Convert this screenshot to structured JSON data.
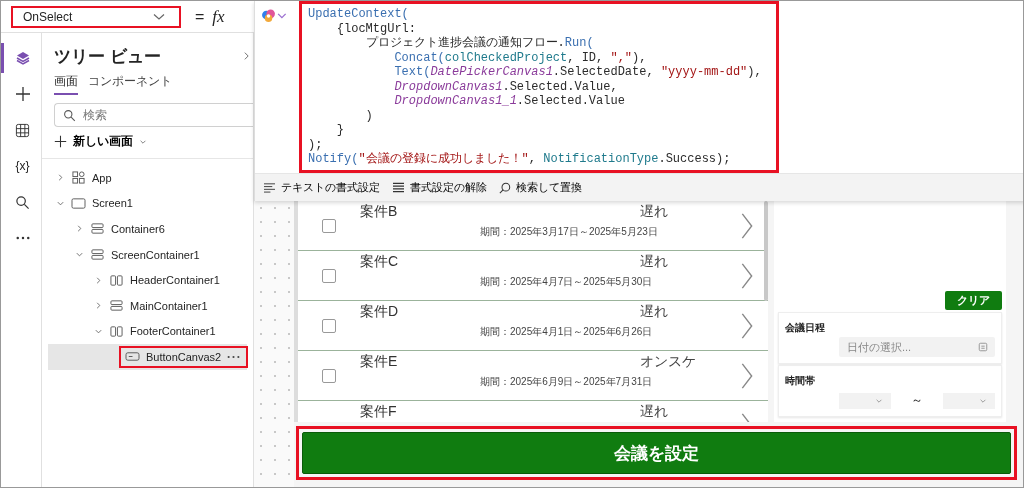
{
  "property_selector": {
    "value": "OnSelect",
    "highlighted": true
  },
  "formula_bar": {
    "equals": "=",
    "fx": "fx",
    "code_highlighted": true,
    "code_lines": [
      {
        "tokens": [
          {
            "kind": "fn",
            "text": "UpdateContext("
          }
        ],
        "children": [
          {
            "tokens": [
              {
                "kind": "plain",
                "text": "{locMtgUrl:"
              }
            ],
            "children": [
              {
                "tokens": [
                  {
                    "kind": "plain",
                    "text": "プロジェクト進捗会議の通知フロー."
                  },
                  {
                    "kind": "fn",
                    "text": "Run("
                  }
                ],
                "children": [
                  {
                    "tokens": [
                      {
                        "kind": "fn",
                        "text": "Concat("
                      },
                      {
                        "kind": "ident",
                        "text": "colCheckedProject"
                      },
                      {
                        "kind": "plain",
                        "text": ", ID, "
                      },
                      {
                        "kind": "str",
                        "text": "\",\""
                      },
                      {
                        "kind": "plain",
                        "text": "),"
                      }
                    ]
                  },
                  {
                    "tokens": [
                      {
                        "kind": "fn",
                        "text": "Text("
                      },
                      {
                        "kind": "ctl",
                        "text": "DatePickerCanvas1"
                      },
                      {
                        "kind": "plain",
                        "text": ".SelectedDate, "
                      },
                      {
                        "kind": "str",
                        "text": "\"yyyy-mm-dd\""
                      },
                      {
                        "kind": "plain",
                        "text": "),"
                      }
                    ]
                  },
                  {
                    "tokens": [
                      {
                        "kind": "ctl",
                        "text": "DropdownCanvas1"
                      },
                      {
                        "kind": "plain",
                        "text": ".Selected.Value,"
                      }
                    ]
                  },
                  {
                    "tokens": [
                      {
                        "kind": "ctl",
                        "text": "DropdownCanvas1_1"
                      },
                      {
                        "kind": "plain",
                        "text": ".Selected.Value"
                      }
                    ]
                  }
                ]
              },
              {
                "tokens": [
                  {
                    "kind": "plain",
                    "text": ")"
                  }
                ]
              }
            ]
          },
          {
            "tokens": [
              {
                "kind": "plain",
                "text": "}"
              }
            ]
          }
        ]
      },
      {
        "tokens": [
          {
            "kind": "plain",
            "text": ");"
          }
        ]
      },
      {
        "tokens": [
          {
            "kind": "fn",
            "text": "Notify("
          },
          {
            "kind": "str",
            "text": "\"会議の登録に成功しました！\""
          },
          {
            "kind": "plain",
            "text": ", "
          },
          {
            "kind": "ident",
            "text": "NotificationType"
          },
          {
            "kind": "plain",
            "text": ".Success);"
          }
        ]
      }
    ],
    "toolbar": [
      {
        "kind": "format",
        "label": "テキストの書式設定"
      },
      {
        "kind": "clear",
        "label": "書式設定の解除"
      },
      {
        "kind": "search",
        "label": "検索して置換"
      }
    ]
  },
  "rail": [
    {
      "kind": "layers",
      "selected": true
    },
    {
      "kind": "plus",
      "selected": false
    },
    {
      "kind": "table",
      "selected": false
    },
    {
      "kind": "text",
      "label": "{x}",
      "selected": false
    },
    {
      "kind": "search",
      "selected": false
    },
    {
      "kind": "more",
      "selected": false
    }
  ],
  "tree": {
    "title": "ツリー ビュー",
    "tabs": [
      {
        "label": "画面",
        "selected": true
      },
      {
        "label": "コンポーネント",
        "selected": false
      }
    ],
    "search": {
      "placeholder": "検索"
    },
    "new_screen": "新しい画面",
    "items": [
      {
        "kind": "app",
        "label": "App",
        "expanded": false,
        "selected": false
      },
      {
        "kind": "screen",
        "label": "Screen1",
        "expanded": true,
        "selected": false,
        "children": [
          {
            "kind": "vertical",
            "label": "Container6",
            "expanded": false,
            "selected": false
          },
          {
            "kind": "vertical",
            "label": "ScreenContainer1",
            "expanded": true,
            "selected": false,
            "children": [
              {
                "kind": "horizontal",
                "label": "HeaderContainer1",
                "expanded": false,
                "selected": false
              },
              {
                "kind": "vertical",
                "label": "MainContainer1",
                "expanded": false,
                "selected": false
              },
              {
                "kind": "horizontal",
                "label": "FooterContainer1",
                "expanded": true,
                "selected": false,
                "children": [
                  {
                    "kind": "button",
                    "label": "ButtonCanvas2",
                    "selected": true,
                    "highlighted": true
                  }
                ]
              }
            ]
          }
        ]
      }
    ]
  },
  "gallery": {
    "rows": [
      {
        "title": "案件B",
        "status": "遅れ",
        "period": "期間：2025年3月17日～2025年5月23日",
        "checked": false
      },
      {
        "title": "案件C",
        "status": "遅れ",
        "period": "期間：2025年4月7日～2025年5月30日",
        "checked": false
      },
      {
        "title": "案件D",
        "status": "遅れ",
        "period": "期間：2025年4月1日～2025年6月26日",
        "checked": false
      },
      {
        "title": "案件E",
        "status": "オンスケ",
        "period": "期間：2025年6月9日～2025年7月31日",
        "checked": false
      },
      {
        "title": "案件F",
        "status": "遅れ"
      }
    ]
  },
  "filter": {
    "clear_button": "クリア",
    "date_label": "会議日程",
    "date_placeholder": "日付の選択...",
    "time_label": "時間帯",
    "time_separator": "～"
  },
  "submit": {
    "label": "会議を設定",
    "highlighted": true
  }
}
